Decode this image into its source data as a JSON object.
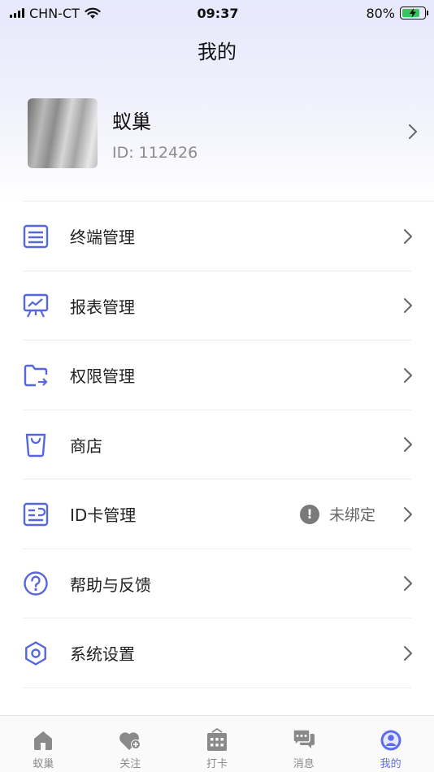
{
  "status_bar": {
    "carrier": "CHN-CT",
    "time": "09:37",
    "battery": "80%"
  },
  "header": {
    "title": "我的"
  },
  "profile": {
    "name": "蚁巢",
    "id_text": "ID: 112426"
  },
  "menu": {
    "items": [
      {
        "label": "终端管理",
        "icon": "terminal-list-icon"
      },
      {
        "label": "报表管理",
        "icon": "report-chart-icon"
      },
      {
        "label": "权限管理",
        "icon": "permission-folder-icon"
      },
      {
        "label": "商店",
        "icon": "shop-bag-icon"
      },
      {
        "label": "ID卡管理",
        "icon": "id-card-icon",
        "status": "未绑定"
      },
      {
        "label": "帮助与反馈",
        "icon": "help-icon"
      },
      {
        "label": "系统设置",
        "icon": "settings-gear-icon"
      }
    ]
  },
  "tabs": [
    {
      "label": "蚁巢",
      "icon": "home-icon"
    },
    {
      "label": "关注",
      "icon": "heart-plus-icon"
    },
    {
      "label": "打卡",
      "icon": "calendar-icon"
    },
    {
      "label": "消息",
      "icon": "message-icon"
    },
    {
      "label": "我的",
      "icon": "profile-icon",
      "active": true
    }
  ],
  "colors": {
    "accent": "#5b6cf0",
    "icon_blue": "#5566e0",
    "tab_inactive": "#8a8a8a",
    "battery_green": "#34c759"
  }
}
